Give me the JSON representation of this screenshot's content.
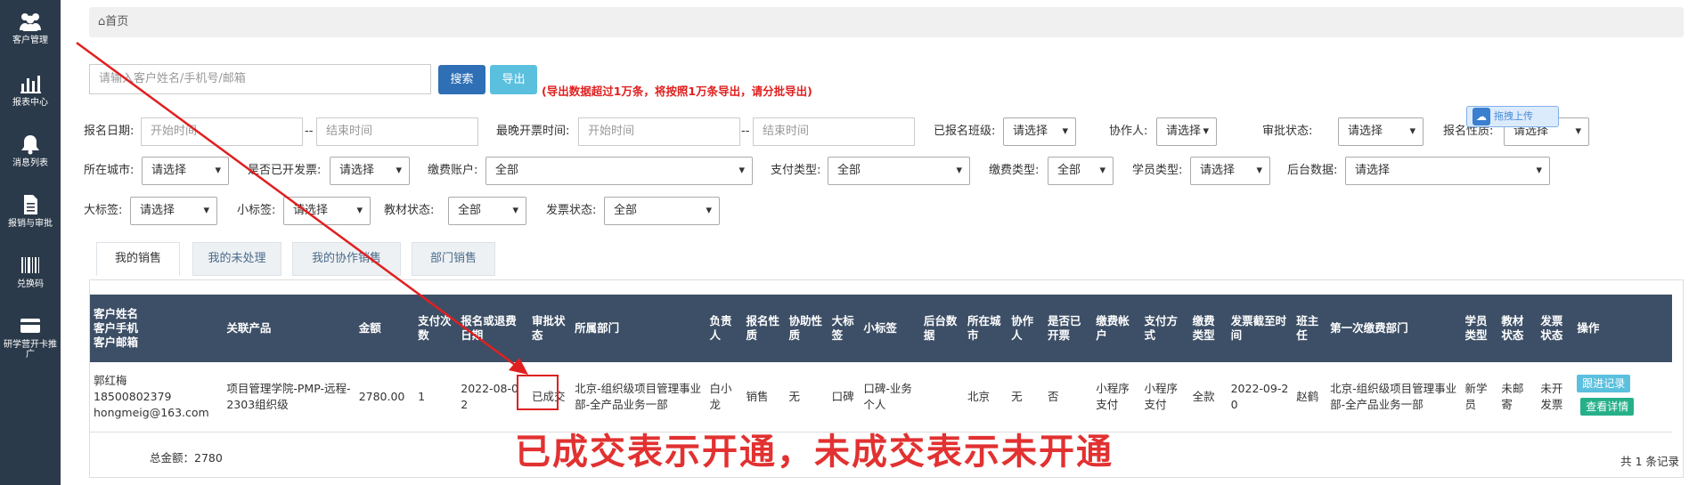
{
  "sidebar": {
    "items": [
      {
        "label": "客户管理",
        "icon": "users-icon"
      },
      {
        "label": "报表中心",
        "icon": "bar-chart-icon"
      },
      {
        "label": "消息列表",
        "icon": "bell-icon"
      },
      {
        "label": "报销与审批",
        "icon": "document-icon"
      },
      {
        "label": "兑换码",
        "icon": "barcode-icon"
      },
      {
        "label": "研学营开卡推广",
        "icon": "card-icon"
      }
    ]
  },
  "breadcrumb": {
    "home": "首页"
  },
  "search": {
    "placeholder": "请输入客户姓名/手机号/邮箱",
    "search_label": "搜索",
    "export_label": "导出",
    "export_note": "(导出数据超过1万条，将按照1万条导出，请分批导出)"
  },
  "filters": {
    "signup_date_label": "报名日期:",
    "start_placeholder": "开始时间",
    "end_placeholder": "结束时间",
    "latest_invoice_label": "最晚开票时间:",
    "signed_class_label": "已报名班级:",
    "collaborator_label": "协作人:",
    "approval_status_label": "审批状态:",
    "signup_nature_label": "报名性质:",
    "city_label": "所在城市:",
    "invoiced_label": "是否已开发票:",
    "payment_account_label": "缴费账户:",
    "payment_type_label": "支付类型:",
    "fee_type_label": "缴费类型:",
    "student_type_label": "学员类型:",
    "backend_data_label": "后台数据:",
    "big_tag_label": "大标签:",
    "small_tag_label": "小标签:",
    "material_status_label": "教材状态:",
    "invoice_status_label": "发票状态:",
    "choose": "请选择",
    "all": "全部",
    "range_dash": "--"
  },
  "upload": {
    "label": "拖拽上传",
    "icon": "upload-cloud-icon"
  },
  "tabs": [
    "我的销售",
    "我的未处理",
    "我的协作销售",
    "部门销售"
  ],
  "table": {
    "headers": [
      "客户姓名\n客户手机\n客户邮箱",
      "关联产品",
      "金额",
      "支付次数",
      "报名或退费日期",
      "审批状态",
      "所属部门",
      "负责人",
      "报名性质",
      "协助性质",
      "大标签",
      "小标签",
      "后台数据",
      "所在城市",
      "协作人",
      "是否已开票",
      "缴费帐户",
      "支付方式",
      "缴费类型",
      "发票截至时间",
      "班主任",
      "第一次缴费部门",
      "学员类型",
      "教材状态",
      "发票状态",
      "操作"
    ],
    "rows": [
      {
        "customer": "郭红梅\n18500802379\nhongmeig@163.com",
        "product": "项目管理学院-PMP-远程-2303组织级",
        "amount": "2780.00",
        "pay_count": "1",
        "date": "2022-08-02",
        "approval": "已成交",
        "dept": "北京-组织级项目管理事业部-全产品业务一部",
        "owner": "白小龙",
        "signup_nature": "销售",
        "assist_nature": "无",
        "big_tag": "口碑",
        "small_tag": "口碑-业务个人",
        "backend": "",
        "city": "北京",
        "collaborator": "无",
        "invoiced": "否",
        "account": "小程序支付",
        "pay_method": "小程序支付",
        "fee_type": "全款",
        "invoice_deadline": "2022-09-20",
        "head_teacher": "赵鹤",
        "first_pay_dept": "北京-组织级项目管理事业部-全产品业务一部",
        "student_type": "新学员",
        "material_status": "未邮寄",
        "invoice_status": "未开发票",
        "action_follow": "跟进记录",
        "action_detail": "查看详情"
      }
    ]
  },
  "footer": {
    "total": "总金额：2780",
    "pager": "共 1 条记录"
  },
  "annotation": {
    "text": "已成交表示开通，未成交表示未开通",
    "color": "#e23131"
  }
}
